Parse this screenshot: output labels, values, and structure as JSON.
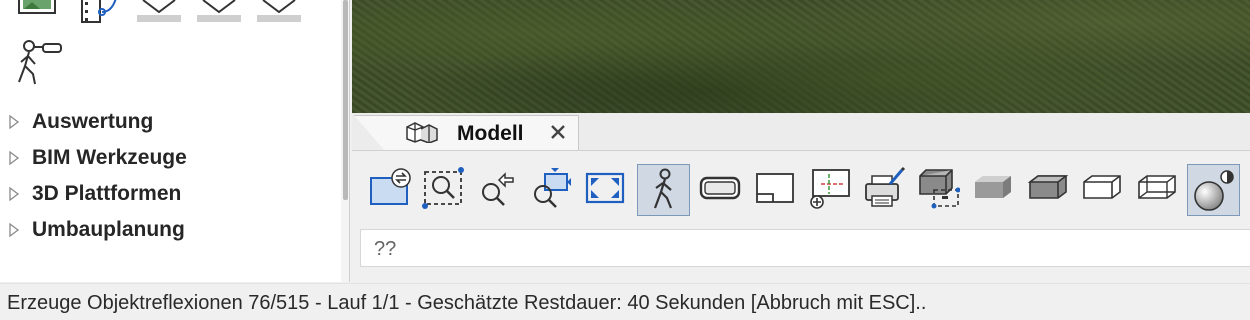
{
  "left_panel": {
    "tree_items": [
      {
        "label": "Auswertung"
      },
      {
        "label": "BIM Werkzeuge"
      },
      {
        "label": "3D Plattformen"
      },
      {
        "label": "Umbauplanung"
      }
    ]
  },
  "tabs": [
    {
      "label": "Modell",
      "icon": "model-boxes-icon",
      "active": true
    }
  ],
  "toolbar": {
    "buttons": [
      {
        "name": "view-exchange-icon"
      },
      {
        "name": "zoom-window-icon"
      },
      {
        "name": "zoom-previous-icon"
      },
      {
        "name": "zoom-next-icon"
      },
      {
        "name": "zoom-all-icon"
      },
      {
        "name": "walk-mode-icon",
        "active": true
      },
      {
        "name": "vr-glasses-icon"
      },
      {
        "name": "section-view-icon"
      },
      {
        "name": "crosshair-axes-icon"
      },
      {
        "name": "print-render-icon"
      },
      {
        "name": "box-select-icon"
      },
      {
        "name": "render-solid-gray-icon"
      },
      {
        "name": "render-shaded-icon"
      },
      {
        "name": "render-hidden-line-icon"
      },
      {
        "name": "render-wireframe-icon"
      },
      {
        "name": "render-sphere-light-icon",
        "active": true
      }
    ]
  },
  "command_line": {
    "text": "??"
  },
  "status_bar": {
    "text": "Erzeuge Objektreflexionen 76/515 - Lauf 1/1 - Geschätzte Restdauer: 40 Sekunden  [Abbruch mit ESC].."
  },
  "colors": {
    "accent_blue": "#1f5fbf",
    "active_button_bg": "#cfd8e3",
    "grass": "#3f4f28"
  }
}
